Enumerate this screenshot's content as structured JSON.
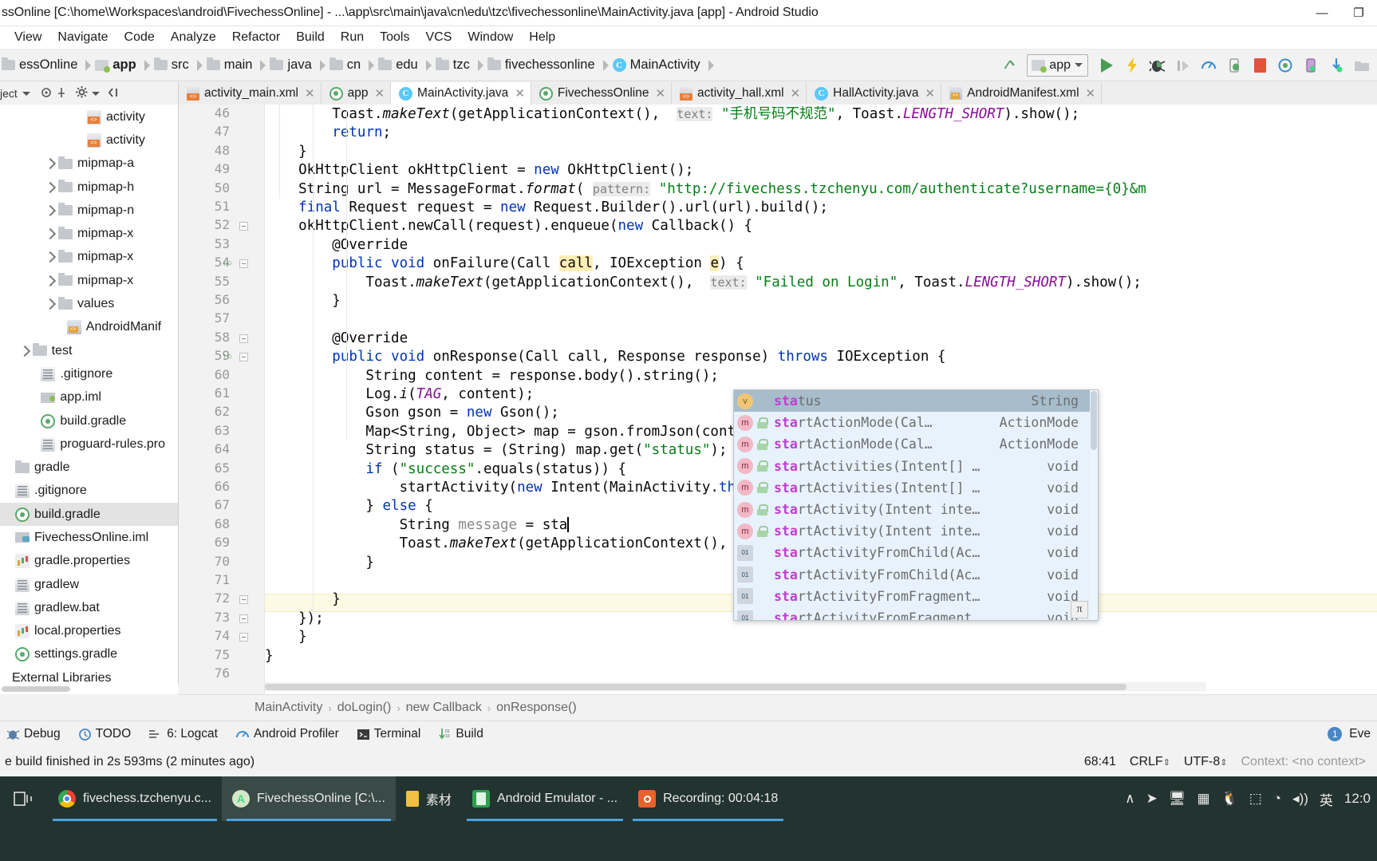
{
  "window": {
    "title": "ssOnline [C:\\home\\Workspaces\\android\\FivechessOnline] - ...\\app\\src\\main\\java\\cn\\edu\\tzc\\fivechessonline\\MainActivity.java [app] - Android Studio",
    "minimize": "—",
    "maximize": "❐"
  },
  "menu": {
    "items": [
      "View",
      "Navigate",
      "Code",
      "Analyze",
      "Refactor",
      "Build",
      "Run",
      "Tools",
      "VCS",
      "Window",
      "Help"
    ]
  },
  "navigation": {
    "crumbs": [
      {
        "label": "essOnline",
        "icon": "folder-icon",
        "bold": false
      },
      {
        "label": "app",
        "icon": "module-icon",
        "bold": true
      },
      {
        "label": "src",
        "icon": "folder-icon",
        "bold": false
      },
      {
        "label": "main",
        "icon": "folder-icon",
        "bold": false
      },
      {
        "label": "java",
        "icon": "folder-icon",
        "bold": false
      },
      {
        "label": "cn",
        "icon": "folder-icon",
        "bold": false
      },
      {
        "label": "edu",
        "icon": "folder-icon",
        "bold": false
      },
      {
        "label": "tzc",
        "icon": "folder-icon",
        "bold": false
      },
      {
        "label": "fivechessonline",
        "icon": "folder-icon",
        "bold": false
      },
      {
        "label": "MainActivity",
        "icon": "class-icon",
        "bold": false
      }
    ],
    "run_config": "app",
    "toolbar_icons": [
      "make-project-icon",
      "run-button",
      "apply-changes-icon",
      "debug-icon",
      "step-icon",
      "profiler-icon",
      "attach-debugger-icon",
      "stop-button",
      "sync-gradle-icon",
      "avd-manager-icon",
      "sdk-manager-icon",
      "device-file-explorer-icon"
    ]
  },
  "project_panel": {
    "title": "ject",
    "tree": [
      {
        "label": "activity",
        "icon": "xml-file-icon",
        "indent": 5,
        "arrow": false,
        "selected": false
      },
      {
        "label": "activity",
        "icon": "xml-file-icon",
        "indent": 5,
        "arrow": false,
        "selected": false
      },
      {
        "label": "mipmap-a",
        "icon": "folder-icon",
        "indent": 3,
        "arrow": true,
        "selected": false
      },
      {
        "label": "mipmap-h",
        "icon": "folder-icon",
        "indent": 3,
        "arrow": true,
        "selected": false
      },
      {
        "label": "mipmap-n",
        "icon": "folder-icon",
        "indent": 3,
        "arrow": true,
        "selected": false
      },
      {
        "label": "mipmap-x",
        "icon": "folder-icon",
        "indent": 3,
        "arrow": true,
        "selected": false
      },
      {
        "label": "mipmap-x",
        "icon": "folder-icon",
        "indent": 3,
        "arrow": true,
        "selected": false
      },
      {
        "label": "mipmap-x",
        "icon": "folder-icon",
        "indent": 3,
        "arrow": true,
        "selected": false
      },
      {
        "label": "values",
        "icon": "folder-icon",
        "indent": 3,
        "arrow": true,
        "selected": false
      },
      {
        "label": "AndroidManif",
        "icon": "manifest-file-icon",
        "indent": 3.6,
        "arrow": false,
        "selected": false
      },
      {
        "label": "test",
        "icon": "folder-icon",
        "indent": 1.2,
        "arrow": true,
        "selected": false
      },
      {
        "label": ".gitignore",
        "icon": "text-file-icon",
        "indent": 1.8,
        "arrow": false,
        "selected": false
      },
      {
        "label": "app.iml",
        "icon": "iml-file-icon",
        "indent": 1.8,
        "arrow": false,
        "selected": false
      },
      {
        "label": "build.gradle",
        "icon": "gradle-file-icon",
        "indent": 1.8,
        "arrow": false,
        "selected": false
      },
      {
        "label": "proguard-rules.pro",
        "icon": "text-file-icon",
        "indent": 1.8,
        "arrow": false,
        "selected": false
      },
      {
        "label": "gradle",
        "icon": "folder-icon",
        "indent": 0,
        "arrow": false,
        "selected": false
      },
      {
        "label": ".gitignore",
        "icon": "text-file-icon",
        "indent": 0,
        "arrow": false,
        "selected": false
      },
      {
        "label": "build.gradle",
        "icon": "gradle-file-icon",
        "indent": 0,
        "arrow": false,
        "selected": true
      },
      {
        "label": "FivechessOnline.iml",
        "icon": "iml-project-icon",
        "indent": 0,
        "arrow": false,
        "selected": false
      },
      {
        "label": "gradle.properties",
        "icon": "properties-file-icon",
        "indent": 0,
        "arrow": false,
        "selected": false
      },
      {
        "label": "gradlew",
        "icon": "text-file-icon",
        "indent": 0,
        "arrow": false,
        "selected": false
      },
      {
        "label": "gradlew.bat",
        "icon": "text-file-icon",
        "indent": 0,
        "arrow": false,
        "selected": false
      },
      {
        "label": "local.properties",
        "icon": "properties-file-icon",
        "indent": 0,
        "arrow": false,
        "selected": false
      },
      {
        "label": "settings.gradle",
        "icon": "gradle-file-icon",
        "indent": 0,
        "arrow": false,
        "selected": false
      },
      {
        "label": "External Libraries",
        "icon": "none",
        "indent": -0.6,
        "arrow": false,
        "selected": false
      }
    ]
  },
  "tabs": [
    {
      "label": "activity_main.xml",
      "icon": "xml-file-icon",
      "active": false
    },
    {
      "label": "app",
      "icon": "gradle-file-icon",
      "active": false
    },
    {
      "label": "MainActivity.java",
      "icon": "java-class-icon",
      "active": true
    },
    {
      "label": "FivechessOnline",
      "icon": "gradle-file-icon",
      "active": false
    },
    {
      "label": "activity_hall.xml",
      "icon": "xml-file-icon",
      "active": false
    },
    {
      "label": "HallActivity.java",
      "icon": "java-class-icon",
      "active": false
    },
    {
      "label": "AndroidManifest.xml",
      "icon": "manifest-file-icon",
      "active": false
    }
  ],
  "editor": {
    "first_line": 46,
    "line_numbers": [
      46,
      47,
      48,
      49,
      50,
      51,
      52,
      53,
      54,
      55,
      56,
      57,
      58,
      59,
      60,
      61,
      62,
      63,
      64,
      65,
      66,
      67,
      68,
      69,
      70,
      71,
      72,
      73,
      74,
      75,
      76
    ],
    "current_line": 68,
    "lines": [
      "        Toast.makeText(getApplicationContext(),  text: \"手机号码不规范\", Toast.LENGTH_SHORT).show();",
      "        return;",
      "    }",
      "    OkHttpClient okHttpClient = new OkHttpClient();",
      "    String url = MessageFormat.format( pattern: \"http://fivechess.tzchenyu.com/authenticate?username={0}&m",
      "    final Request request = new Request.Builder().url(url).build();",
      "    okHttpClient.newCall(request).enqueue(new Callback() {",
      "        @Override",
      "        public void onFailure(Call call, IOException e) {",
      "            Toast.makeText(getApplicationContext(),  text: \"Failed on Login\", Toast.LENGTH_SHORT).show();",
      "        }",
      "",
      "        @Override",
      "        public void onResponse(Call call, Response response) throws IOException {",
      "            String content = response.body().string();",
      "            Log.i(TAG, content);",
      "            Gson gson = new Gson();",
      "            Map<String, Object> map = gson.fromJson(content, Map.class);",
      "            String status = (String) map.get(\"status\");",
      "            if (\"success\".equals(status)) {",
      "                startActivity(new Intent(MainActivity.this, HallActivity.class));",
      "            } else {",
      "                String message = sta",
      "                Toast.makeText(getApplicationContext(),  resId: )",
      "            }",
      "",
      "        }",
      "    });",
      "    }",
      "}",
      ""
    ],
    "breadcrumb": [
      "MainActivity",
      "doLogin()",
      "new Callback",
      "onResponse()"
    ]
  },
  "completion": {
    "items": [
      {
        "icon": "v",
        "lock": false,
        "name_match": "sta",
        "name_rest": "tus",
        "ret": "String",
        "selected": true
      },
      {
        "icon": "m",
        "lock": true,
        "name_match": "sta",
        "name_rest": "rtActionMode(Cal…",
        "ret": "ActionMode",
        "selected": false
      },
      {
        "icon": "m",
        "lock": true,
        "name_match": "sta",
        "name_rest": "rtActionMode(Cal…",
        "ret": "ActionMode",
        "selected": false
      },
      {
        "icon": "m",
        "lock": true,
        "name_match": "sta",
        "name_rest": "rtActivities(Intent[] …",
        "ret": "void",
        "selected": false
      },
      {
        "icon": "m",
        "lock": true,
        "name_match": "sta",
        "name_rest": "rtActivities(Intent[] …",
        "ret": "void",
        "selected": false
      },
      {
        "icon": "m",
        "lock": true,
        "name_match": "sta",
        "name_rest": "rtActivity(Intent inte…",
        "ret": "void",
        "selected": false
      },
      {
        "icon": "m",
        "lock": true,
        "name_match": "sta",
        "name_rest": "rtActivity(Intent inte…",
        "ret": "void",
        "selected": false
      },
      {
        "icon": "sq",
        "lock": false,
        "name_match": "sta",
        "name_rest": "rtActivityFromChild(Ac…",
        "ret": "void",
        "selected": false
      },
      {
        "icon": "sq",
        "lock": false,
        "name_match": "sta",
        "name_rest": "rtActivityFromChild(Ac…",
        "ret": "void",
        "selected": false
      },
      {
        "icon": "sq",
        "lock": false,
        "name_match": "sta",
        "name_rest": "rtActivityFromFragment…",
        "ret": "void",
        "selected": false
      },
      {
        "icon": "sq",
        "lock": false,
        "name_match": "sta",
        "name_rest": "rtActivityFromFragment",
        "ret": "void",
        "selected": false
      }
    ],
    "badge": "π"
  },
  "bottom_tools": [
    {
      "label": "Debug",
      "icon": "debug-icon"
    },
    {
      "label": "TODO",
      "icon": "todo-icon"
    },
    {
      "label": "6: Logcat",
      "icon": "logcat-icon"
    },
    {
      "label": "Android Profiler",
      "icon": "profiler-icon"
    },
    {
      "label": "Terminal",
      "icon": "terminal-icon"
    },
    {
      "label": "Build",
      "icon": "build-icon"
    }
  ],
  "bottom_right": {
    "count": "1",
    "label": "Eve"
  },
  "status": {
    "message": "e build finished in 2s 593ms (2 minutes ago)",
    "position": "68:41",
    "line_sep": "CRLF",
    "encoding": "UTF-8",
    "context": "Context: <no context>"
  },
  "taskbar": {
    "items": [
      {
        "label": "fivechess.tzchenyu.c...",
        "icon": "chrome-icon",
        "state": "run"
      },
      {
        "label": "FivechessOnline [C:\\...",
        "icon": "android-studio-icon",
        "state": "active"
      },
      {
        "label": "素材",
        "icon": "folder-icon",
        "state": "none"
      },
      {
        "label": "Android Emulator - ...",
        "icon": "emulator-icon",
        "state": "run"
      },
      {
        "label": "Recording: 00:04:18",
        "icon": "recorder-icon",
        "state": "run"
      }
    ],
    "tray": [
      "∧",
      "➤",
      "🖥",
      "▦",
      "🐧",
      "⬚",
      "◔",
      "◂))",
      "英"
    ],
    "clock": "12:0"
  },
  "colors": {
    "keyword": "#0033b3",
    "string": "#067d17",
    "static_field": "#871094",
    "accent_green": "#59a869",
    "accent_red": "#e0533d",
    "popup_bg": "#e7f2fc",
    "popup_sel": "#a7bdcc",
    "taskbar_bg": "#23332f"
  }
}
